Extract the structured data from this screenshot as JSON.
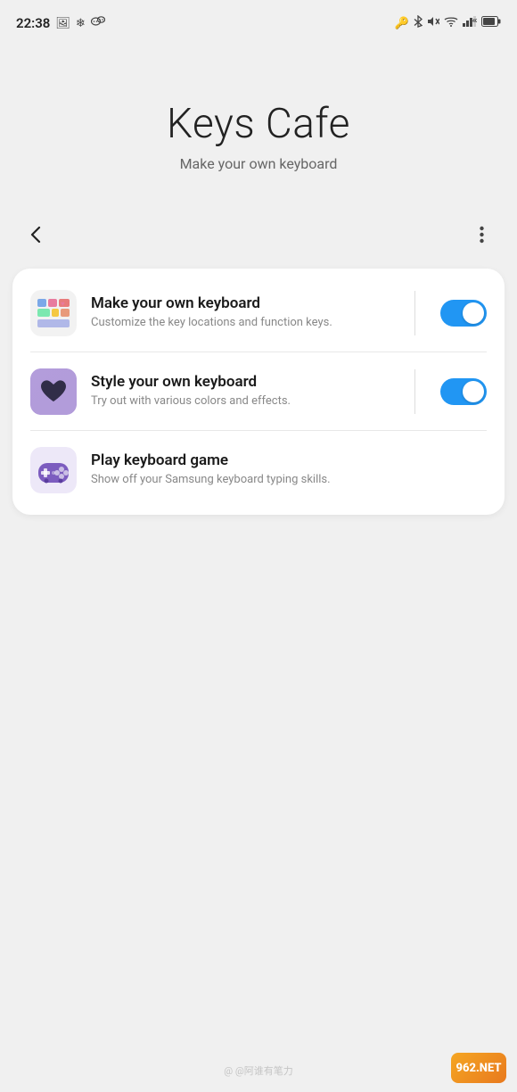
{
  "statusBar": {
    "time": "22:38",
    "icons_left": [
      "photo-icon",
      "snowflake-icon",
      "wechat-icon"
    ],
    "icons_right": [
      "key-icon",
      "bluetooth-icon",
      "mute-icon",
      "wifi-icon",
      "4g-icon",
      "battery-icon"
    ]
  },
  "hero": {
    "title": "Keys Cafe",
    "subtitle": "Make your own keyboard"
  },
  "nav": {
    "back_label": "<",
    "more_label": "⋮"
  },
  "card": {
    "items": [
      {
        "id": "make-keyboard",
        "title": "Make your own keyboard",
        "description": "Customize the key locations and function keys.",
        "icon": "keyboard-icon",
        "toggle": true
      },
      {
        "id": "style-keyboard",
        "title": "Style your own keyboard",
        "description": "Try out with various colors and effects.",
        "icon": "style-icon",
        "toggle": true
      },
      {
        "id": "play-game",
        "title": "Play keyboard game",
        "description": "Show off your Samsung keyboard typing skills.",
        "icon": "game-icon",
        "toggle": false
      }
    ]
  },
  "watermark": {
    "text": "@ @阿谁有笔力"
  },
  "badge": {
    "text": "962.NET"
  }
}
